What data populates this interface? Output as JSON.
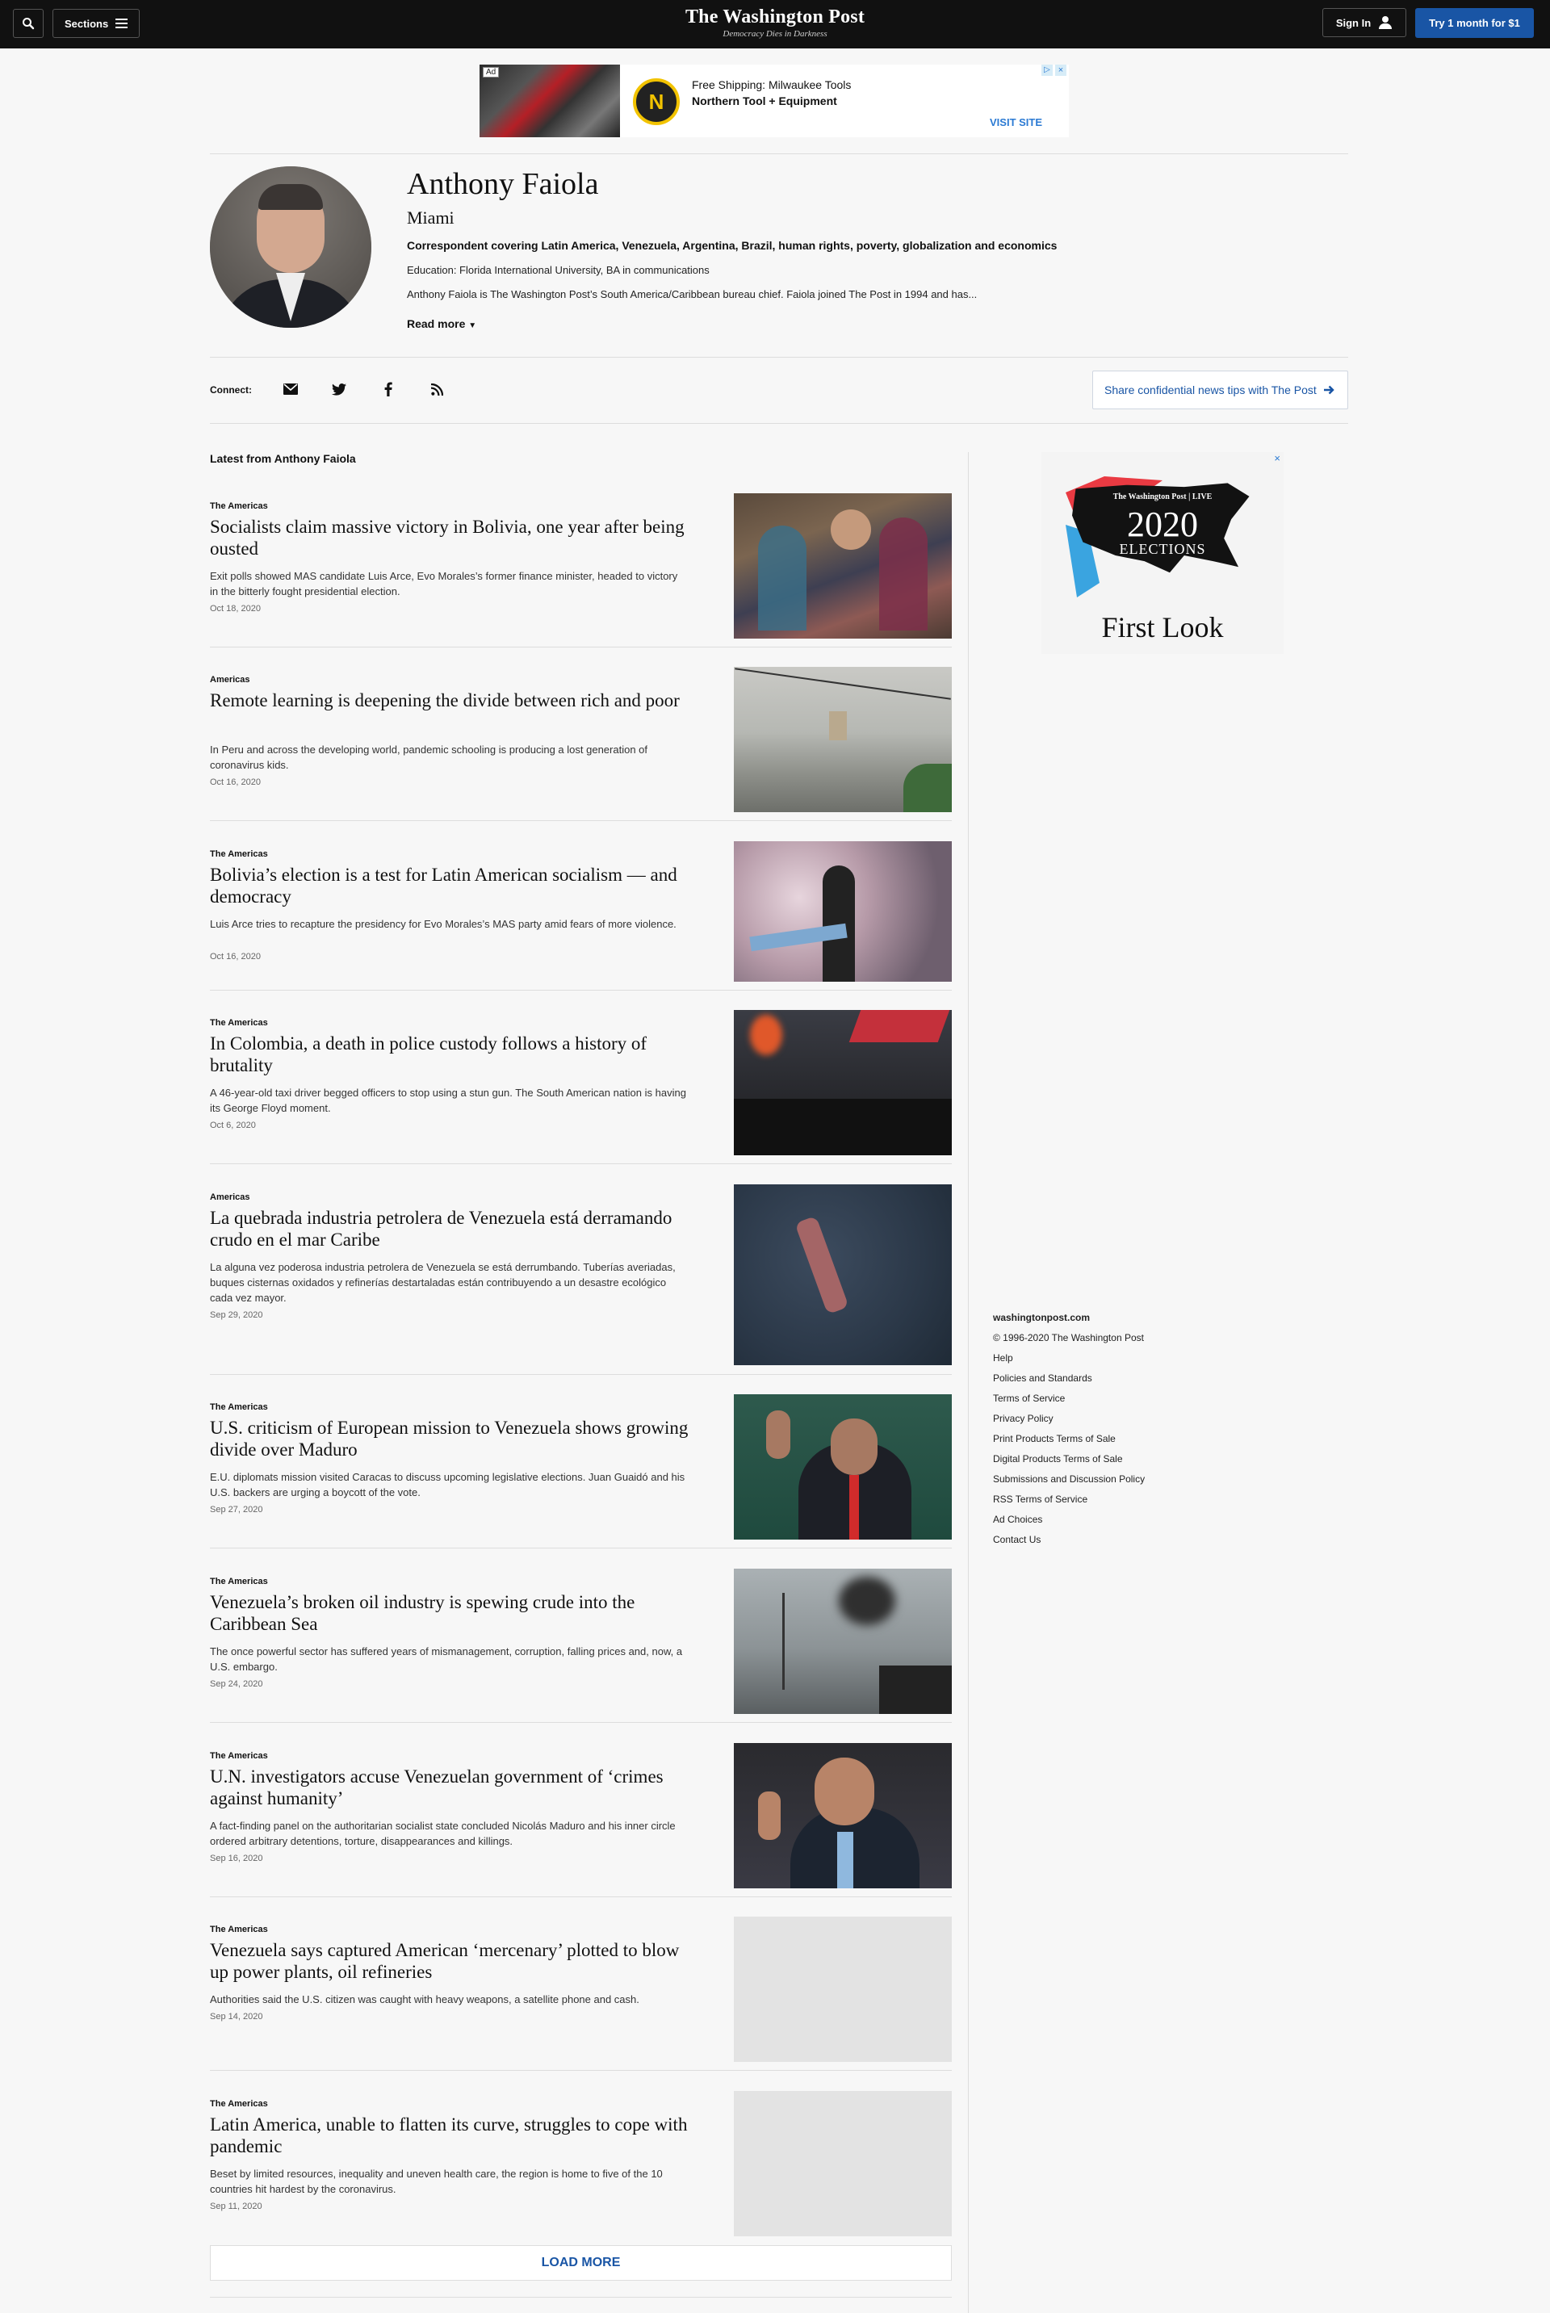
{
  "header": {
    "sections_label": "Sections",
    "logo_title": "The Washington Post",
    "logo_tagline": "Democracy Dies in Darkness",
    "signin_label": "Sign In",
    "subscribe_label": "Try 1 month for $1"
  },
  "ad_banner": {
    "tag": "Ad",
    "line1": "Free Shipping: Milwaukee Tools",
    "line2": "Northern Tool + Equipment",
    "cta": "VISIT SITE",
    "logo_letter": "N"
  },
  "author": {
    "name": "Anthony Faiola",
    "location": "Miami",
    "role": "Correspondent covering Latin America, Venezuela, Argentina, Brazil, human rights, poverty, globalization and economics",
    "education": "Education: Florida International University, BA in communications",
    "bio": "Anthony Faiola is The Washington Post’s South America/Caribbean bureau chief. Faiola joined The Post in 1994 and has...",
    "read_more": "Read more"
  },
  "connect": {
    "label": "Connect:",
    "icons": [
      "email-icon",
      "twitter-icon",
      "facebook-icon",
      "rss-icon"
    ],
    "tips_label": "Share confidential news tips with The Post"
  },
  "latest": {
    "heading": "Latest from Anthony Faiola",
    "stories": [
      {
        "kicker": "The Americas",
        "headline": "Socialists claim massive victory in Bolivia, one year after being ousted",
        "blurb": "Exit polls showed MAS candidate Luis Arce, Evo Morales’s former finance minister, headed to victory in the bitterly fought presidential election.",
        "date": "Oct 18, 2020"
      },
      {
        "kicker": "Americas",
        "headline": "Remote learning is deepening the divide between rich and poor",
        "blurb": "In Peru and across the developing world, pandemic schooling is producing a lost generation of coronavirus kids.",
        "date": "Oct 16, 2020"
      },
      {
        "kicker": "The Americas",
        "headline": "Bolivia’s election is a test for Latin American socialism — and democracy",
        "blurb": "Luis Arce tries to recapture the presidency for Evo Morales’s MAS party amid fears of more violence.",
        "date": "Oct 16, 2020"
      },
      {
        "kicker": "The Americas",
        "headline": "In Colombia, a death in police custody follows a history of brutality",
        "blurb": "A 46-year-old taxi driver begged officers to stop using a stun gun. The South American nation is having its George Floyd moment.",
        "date": "Oct 6, 2020"
      },
      {
        "kicker": "Americas",
        "headline": "La quebrada industria petrolera de Venezuela está derramando crudo en el mar Caribe",
        "blurb": "La alguna vez poderosa industria petrolera de Venezuela se está derrumbando. Tuberías averiadas, buques cisternas oxidados y refinerías destartaladas están contribuyendo a un desastre ecológico cada vez mayor.",
        "date": "Sep 29, 2020"
      },
      {
        "kicker": "The Americas",
        "headline": "U.S. criticism of European mission to Venezuela shows growing divide over Maduro",
        "blurb": "E.U. diplomats mission visited Caracas to discuss upcoming legislative elections. Juan Guaidó and his U.S. backers are urging a boycott of the vote.",
        "date": "Sep 27, 2020"
      },
      {
        "kicker": "The Americas",
        "headline": "Venezuela’s broken oil industry is spewing crude into the Caribbean Sea",
        "blurb": "The once powerful sector has suffered years of mismanagement, corruption, falling prices and, now, a U.S. embargo.",
        "date": "Sep 24, 2020"
      },
      {
        "kicker": "The Americas",
        "headline": "U.N. investigators accuse Venezuelan government of ‘crimes against humanity’",
        "blurb": "A fact-finding panel on the authoritarian socialist state concluded Nicolás Maduro and his inner circle ordered arbitrary detentions, torture, disappearances and killings.",
        "date": "Sep 16, 2020"
      },
      {
        "kicker": "The Americas",
        "headline": "Venezuela says captured American ‘mercenary’ plotted to blow up power plants, oil refineries",
        "blurb": "Authorities said the U.S. citizen was caught with heavy weapons, a satellite phone and cash.",
        "date": "Sep 14, 2020"
      },
      {
        "kicker": "The Americas",
        "headline": "Latin America, unable to flatten its curve, struggles to cope with pandemic",
        "blurb": "Beset by limited resources, inequality and uneven health care, the region is home to five of the 10 countries hit hardest by the coronavirus.",
        "date": "Sep 11, 2020"
      }
    ],
    "load_more": "LOAD MORE"
  },
  "side_ad": {
    "brand": "The Washington Post | LIVE",
    "year": "2020",
    "title": "ELECTIONS",
    "subtitle": "First Look"
  },
  "footer": {
    "site": "washingtonpost.com",
    "copyright": "© 1996-2020 The Washington Post",
    "links": [
      "Help",
      "Policies and Standards",
      "Terms of Service",
      "Privacy Policy",
      "Print Products Terms of Sale",
      "Digital Products Terms of Sale",
      "Submissions and Discussion Policy",
      "RSS Terms of Service",
      "Ad Choices",
      "Contact Us"
    ]
  },
  "colors": {
    "topbar": "#111111",
    "accent_blue": "#1955a5",
    "page_bg": "#f7f7f7"
  }
}
